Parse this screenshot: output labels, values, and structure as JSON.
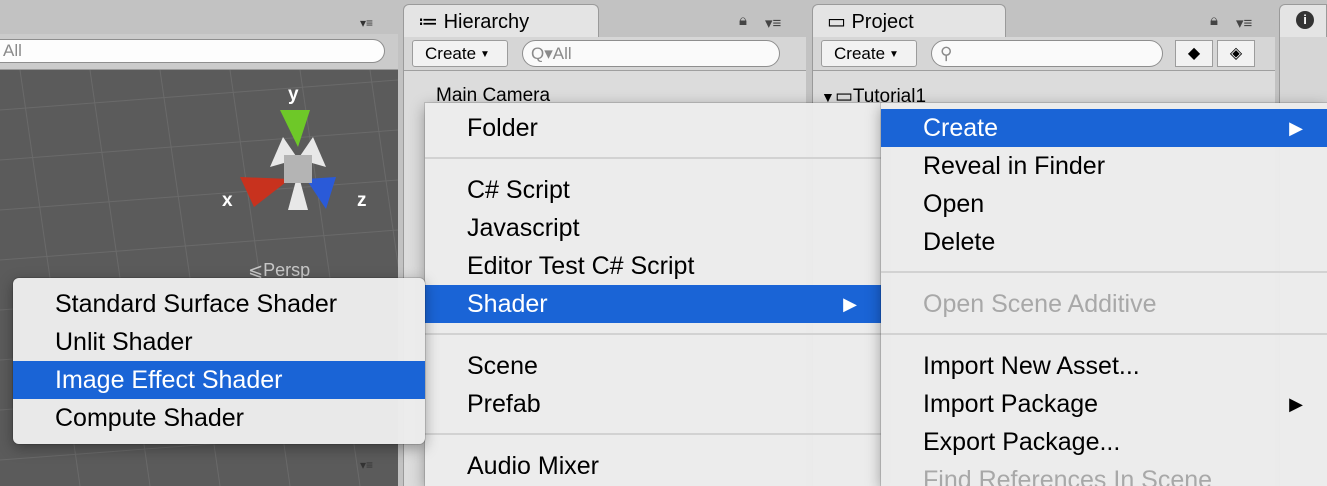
{
  "scene": {
    "search_placeholder": "All",
    "axis_x": "x",
    "axis_y": "y",
    "axis_z": "z",
    "persp_label": "Persp",
    "panel_menu": "▾≡"
  },
  "hierarchy": {
    "tab_title": "Hierarchy",
    "tab_icon": "≔",
    "create_label": "Create",
    "search_placeholder": "All",
    "rows": [
      "Main Camera"
    ]
  },
  "project": {
    "tab_title": "Project",
    "create_label": "Create",
    "folder_name": "Tutorial1"
  },
  "create_submenu": {
    "items": [
      {
        "label": "Folder"
      },
      {
        "label": "C# Script"
      },
      {
        "label": "Javascript"
      },
      {
        "label": "Editor Test C# Script"
      },
      {
        "label": "Shader",
        "has_submenu": true,
        "highlighted": true
      },
      {
        "label": "Scene"
      },
      {
        "label": "Prefab"
      },
      {
        "label": "Audio Mixer"
      }
    ]
  },
  "shader_submenu": {
    "items": [
      {
        "label": "Standard Surface Shader"
      },
      {
        "label": "Unlit Shader"
      },
      {
        "label": "Image Effect Shader",
        "highlighted": true
      },
      {
        "label": "Compute Shader"
      }
    ]
  },
  "context_menu": {
    "items": [
      {
        "label": "Create",
        "has_submenu": true,
        "highlighted": true
      },
      {
        "label": "Reveal in Finder"
      },
      {
        "label": "Open"
      },
      {
        "label": "Delete"
      },
      {
        "label": "Open Scene Additive",
        "disabled": true
      },
      {
        "label": "Import New Asset..."
      },
      {
        "label": "Import Package",
        "has_submenu": true
      },
      {
        "label": "Export Package..."
      },
      {
        "label": "Find References In Scene",
        "disabled": true
      }
    ]
  },
  "colors": {
    "highlight": "#1a64d6",
    "axis_x": "#c8321e",
    "axis_y": "#6ec828",
    "axis_z": "#2a5ad8"
  }
}
